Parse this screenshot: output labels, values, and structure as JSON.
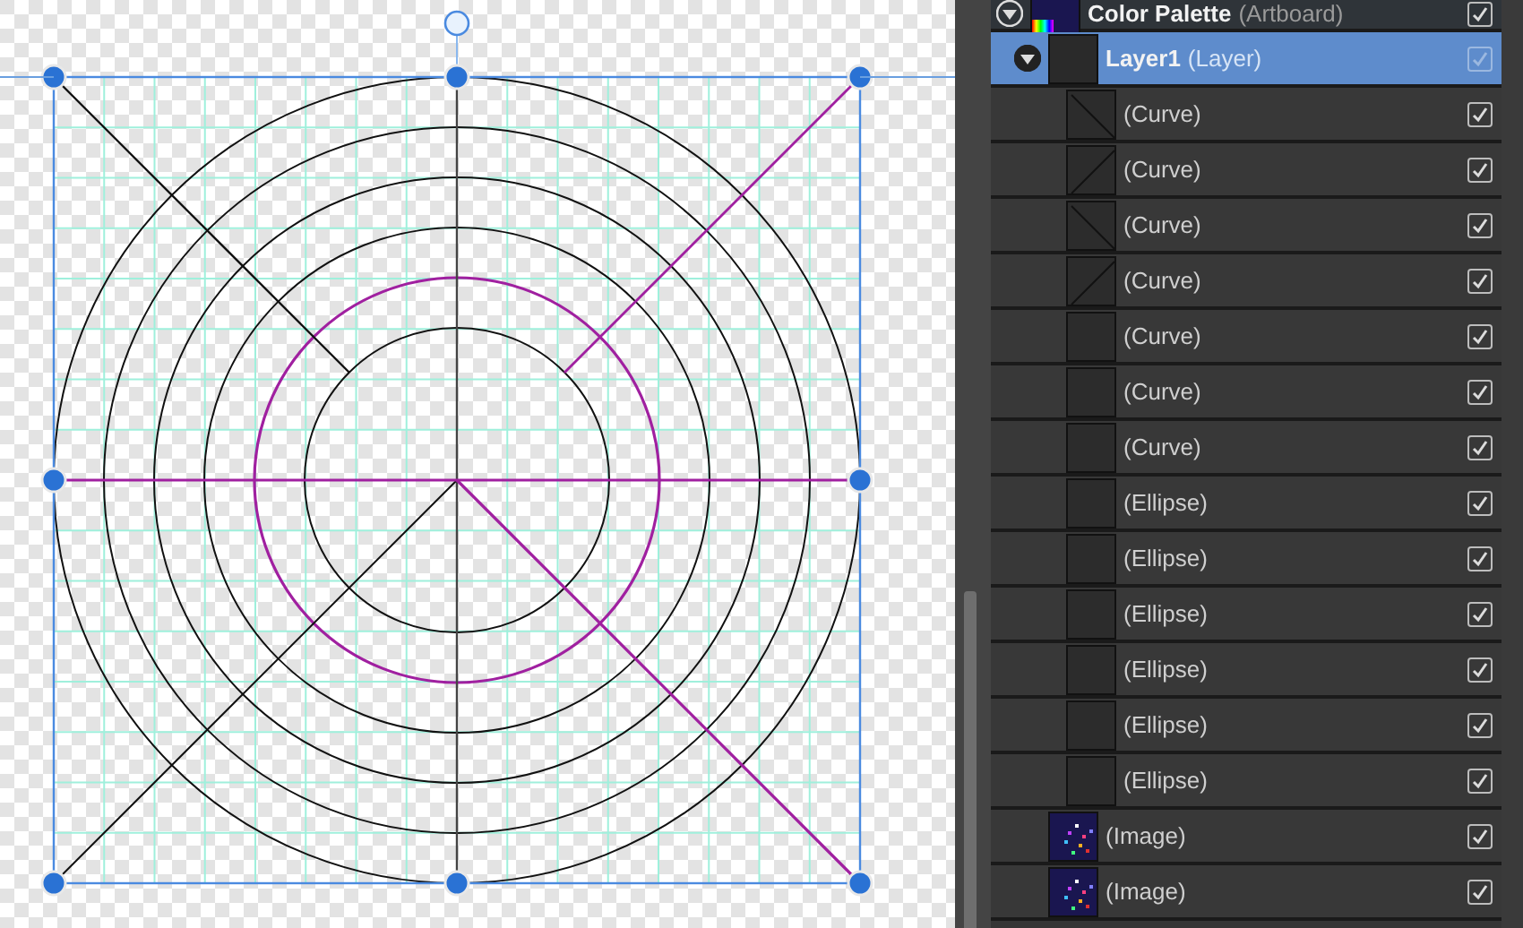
{
  "layers": [
    {
      "kind": "artboard",
      "name": "Color Palette",
      "type": "(Artboard)",
      "expanded": true,
      "visible": true,
      "selected": false,
      "children": [
        {
          "kind": "layer",
          "name": "Layer1",
          "type": "(Layer)",
          "expanded": true,
          "visible": true,
          "selected": true,
          "children": [
            {
              "kind": "curve",
              "type": "(Curve)",
              "visible": true,
              "selected": false
            },
            {
              "kind": "curve",
              "type": "(Curve)",
              "visible": true,
              "selected": false
            },
            {
              "kind": "curve",
              "type": "(Curve)",
              "visible": true,
              "selected": false
            },
            {
              "kind": "curve",
              "type": "(Curve)",
              "visible": true,
              "selected": false
            },
            {
              "kind": "curve",
              "type": "(Curve)",
              "visible": true,
              "selected": false
            },
            {
              "kind": "curve",
              "type": "(Curve)",
              "visible": true,
              "selected": false
            },
            {
              "kind": "curve",
              "type": "(Curve)",
              "visible": true,
              "selected": false
            },
            {
              "kind": "ellipse",
              "type": "(Ellipse)",
              "visible": true,
              "selected": false
            },
            {
              "kind": "ellipse",
              "type": "(Ellipse)",
              "visible": true,
              "selected": false
            },
            {
              "kind": "ellipse",
              "type": "(Ellipse)",
              "visible": true,
              "selected": false
            },
            {
              "kind": "ellipse",
              "type": "(Ellipse)",
              "visible": true,
              "selected": false
            },
            {
              "kind": "ellipse",
              "type": "(Ellipse)",
              "visible": true,
              "selected": false
            },
            {
              "kind": "ellipse",
              "type": "(Ellipse)",
              "visible": true,
              "selected": false
            }
          ]
        },
        {
          "kind": "image",
          "type": "(Image)",
          "visible": true,
          "selected": false
        },
        {
          "kind": "image",
          "type": "(Image)",
          "visible": true,
          "selected": false
        }
      ]
    }
  ]
}
